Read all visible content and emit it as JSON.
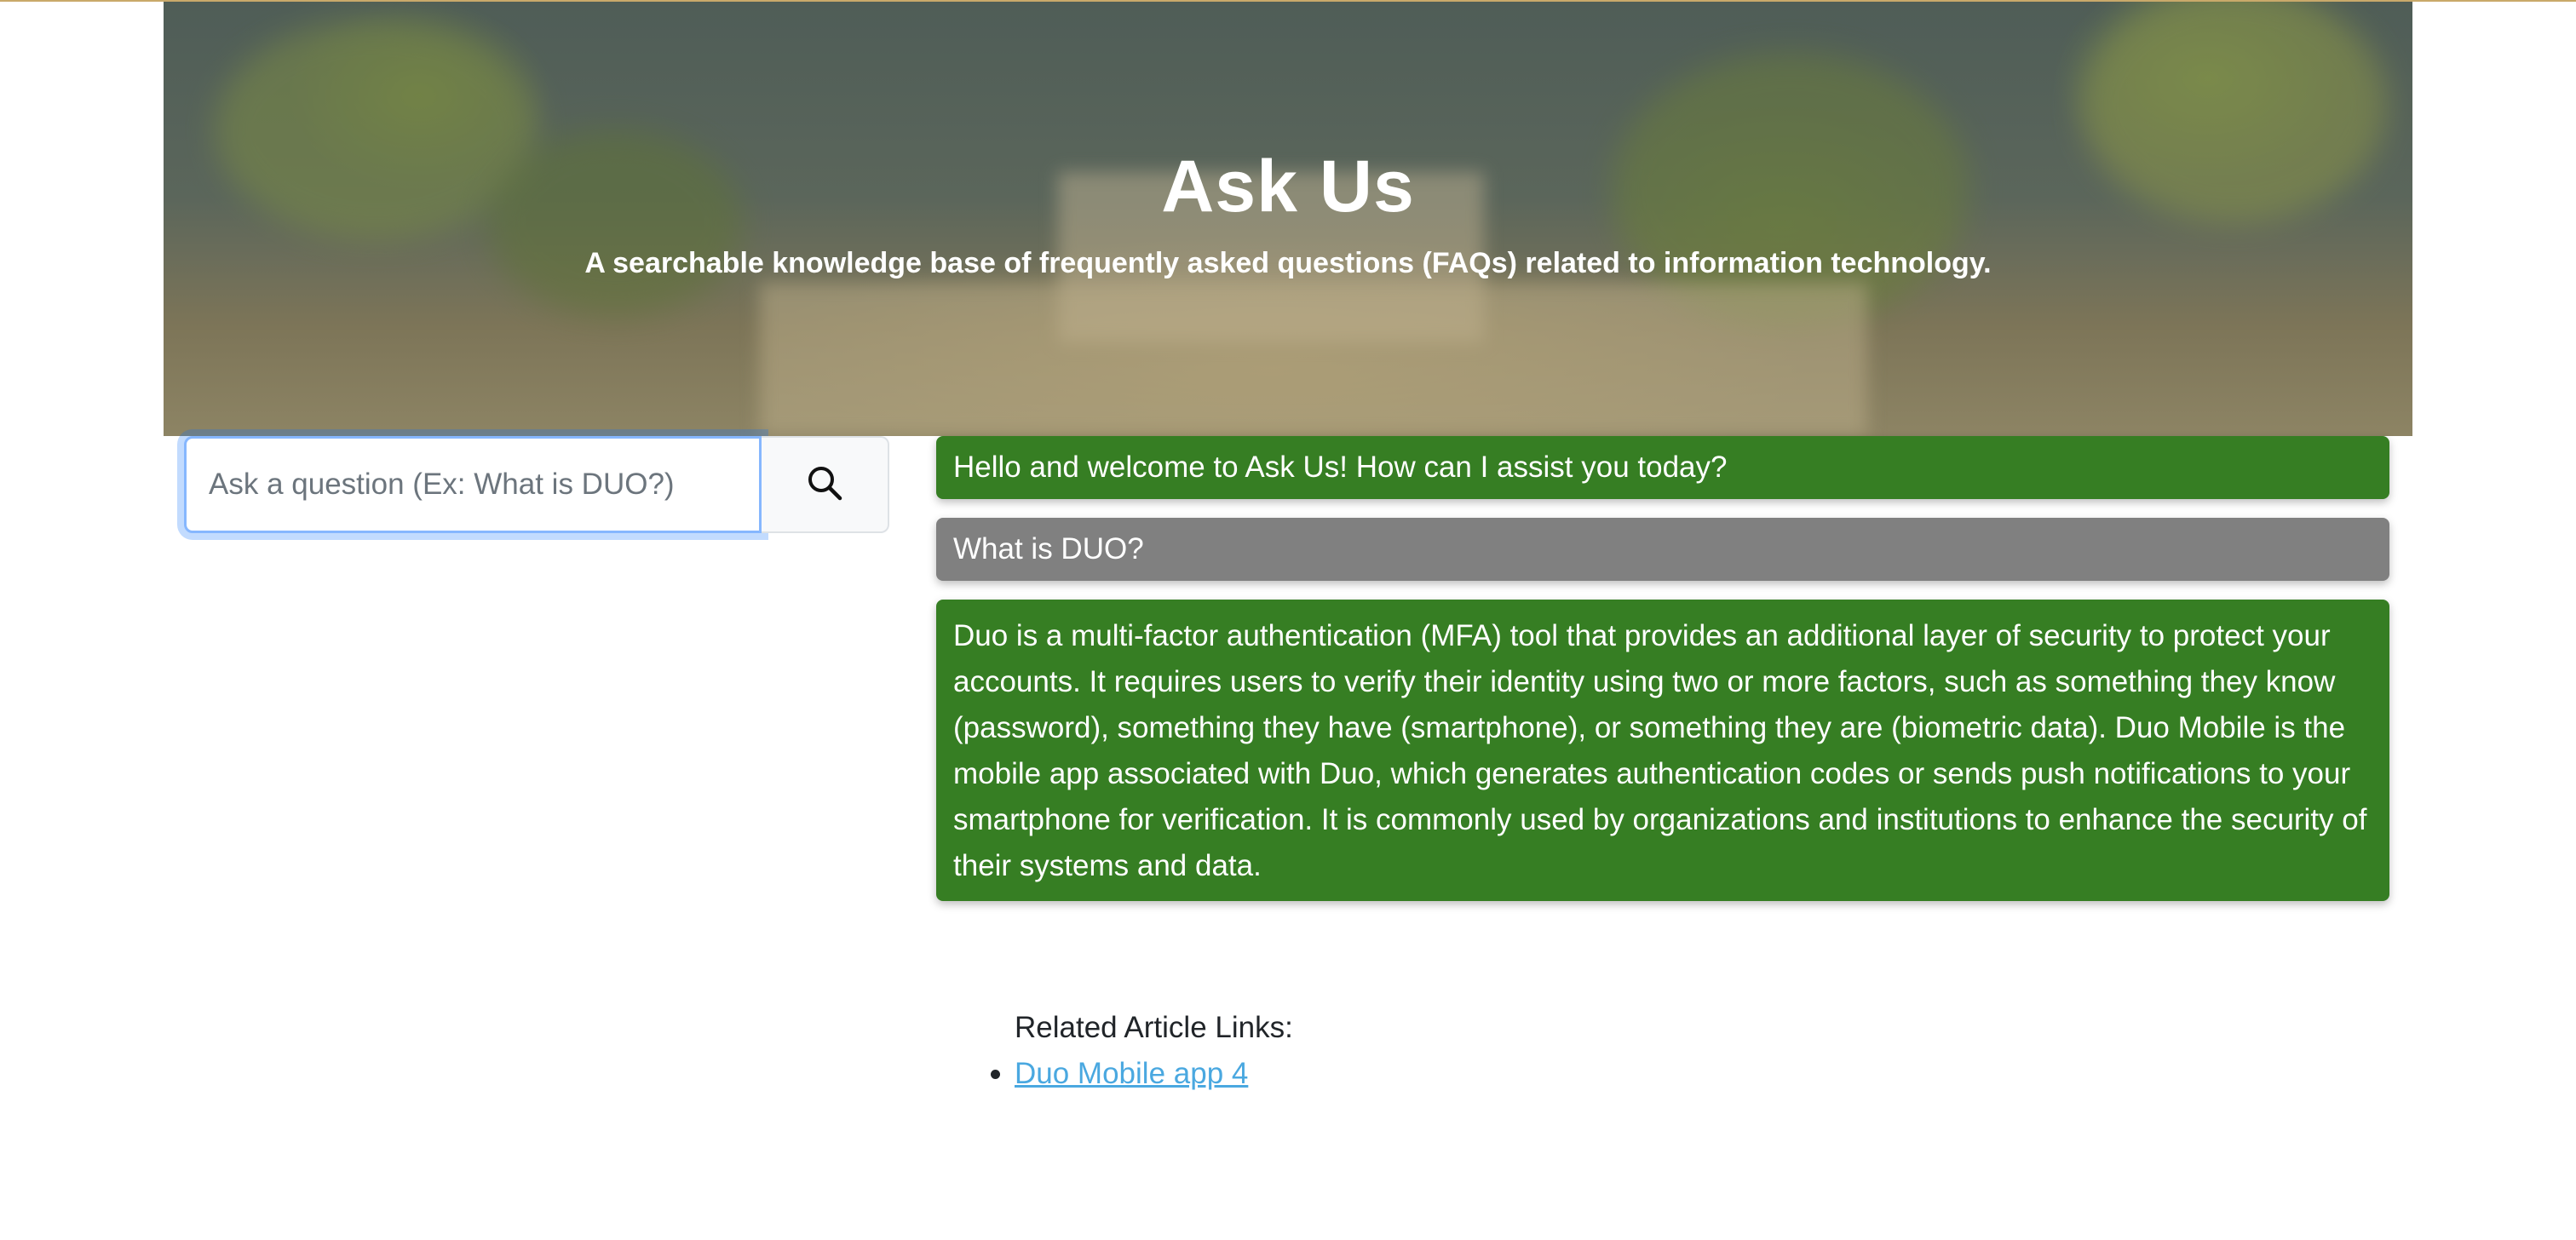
{
  "hero": {
    "title": "Ask Us",
    "subtitle": "A searchable knowledge base of frequently asked questions (FAQs) related to information technology."
  },
  "search": {
    "placeholder": "Ask a question (Ex: What is DUO?)",
    "value": "",
    "button_icon": "search-icon"
  },
  "messages": [
    {
      "role": "bot",
      "text": "Hello and welcome to Ask Us! How can I assist you today?"
    },
    {
      "role": "user",
      "text": "What is DUO?"
    },
    {
      "role": "bot",
      "text": "Duo is a multi-factor authentication (MFA) tool that provides an additional layer of security to protect your accounts. It requires users to verify their identity using two or more factors, such as something they know (password), something they have (smartphone), or something they are (biometric data). Duo Mobile is the mobile app associated with Duo, which generates authentication codes or sends push notifications to your smartphone for verification. It is commonly used by organizations and institutions to enhance the security of their systems and data."
    }
  ],
  "related": {
    "label": "Related Article Links:",
    "links": [
      "Duo Mobile app 4"
    ]
  },
  "colors": {
    "bot_bubble": "#367e23",
    "user_bubble": "#808080",
    "link": "#4aa8e0",
    "focus_ring": "#86b7fe"
  }
}
